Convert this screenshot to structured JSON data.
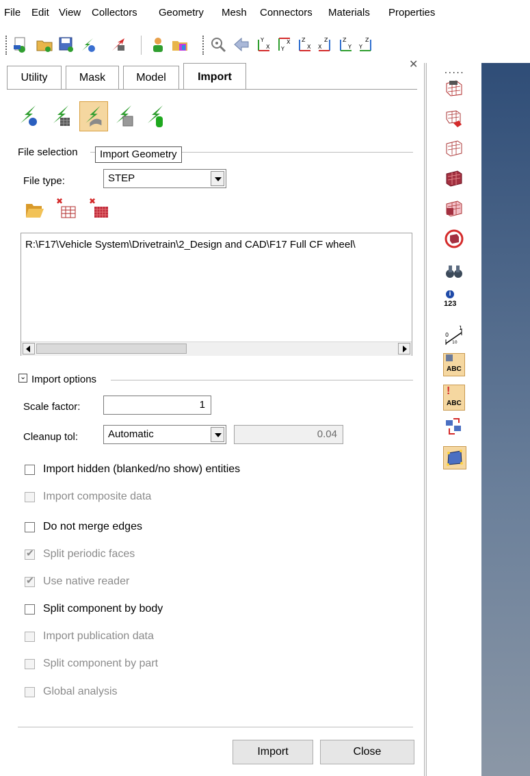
{
  "menu": [
    "File",
    "Edit",
    "View",
    "Collectors",
    "Geometry",
    "Mesh",
    "Connectors",
    "Materials",
    "Properties"
  ],
  "toolbar_icons": [
    "new-model-icon",
    "open-model-icon",
    "save-model-icon",
    "import-icon",
    "export-icon",
    "user-icon",
    "results-icon",
    "zoom-icon",
    "back-arrow-icon",
    "view-xy-top-icon",
    "view-xy-bottom-icon",
    "view-zx-icon",
    "view-xz-icon",
    "view-zy-icon",
    "view-yz-icon"
  ],
  "tabs": [
    {
      "label": "Utility"
    },
    {
      "label": "Mask"
    },
    {
      "label": "Model"
    },
    {
      "label": "Import",
      "active": true
    }
  ],
  "import_type_icons": [
    "import-model-icon",
    "import-fe-icon",
    "import-geometry-icon",
    "import-solver-deck-icon",
    "import-connectors-icon"
  ],
  "tooltip": "Import Geometry",
  "file_selection": {
    "title": "File selection",
    "file_type_label": "File type:",
    "file_type_value": "STEP",
    "icons": [
      "open-folder-icon",
      "remove-file-icon",
      "remove-all-files-icon"
    ],
    "path": "R:\\F17\\Vehicle System\\Drivetrain\\2_Design and CAD\\F17 Full CF wheel\\"
  },
  "import_options": {
    "title": "Import options",
    "scale_label": "Scale factor:",
    "scale_value": "1",
    "cleanup_label": "Cleanup tol:",
    "cleanup_mode": "Automatic",
    "cleanup_value": "0.04",
    "checkboxes": [
      {
        "label": "Import hidden (blanked/no show) entities",
        "checked": false,
        "enabled": true
      },
      {
        "label": "Import composite data",
        "checked": false,
        "enabled": false
      },
      {
        "label": "Do not merge edges",
        "checked": false,
        "enabled": true
      },
      {
        "label": "Split periodic faces",
        "checked": true,
        "enabled": false
      },
      {
        "label": "Use native reader",
        "checked": true,
        "enabled": false
      },
      {
        "label": "Split component by body",
        "checked": false,
        "enabled": true
      },
      {
        "label": "Import publication data",
        "checked": false,
        "enabled": false
      },
      {
        "label": "Split component by part",
        "checked": false,
        "enabled": false
      },
      {
        "label": "Global analysis",
        "checked": false,
        "enabled": false
      }
    ]
  },
  "buttons": {
    "import": "Import",
    "close": "Close"
  },
  "right_toolbar_icons": [
    "dots-menu-icon",
    "surface-mesh-icon",
    "remove-mesh-icon",
    "plane-mesh-icon",
    "solid-mesh-icon",
    "shaded-mesh-icon",
    "mesh-target-icon",
    "binoculars-icon",
    "info-123-icon",
    "measure-icon",
    "label-abc-icon",
    "error-label-abc-icon",
    "swap-elements-icon",
    "quality-frame-icon"
  ],
  "right_toolbar_text": {
    "info": "123",
    "abc1": "ABC",
    "abc2": "ABC"
  },
  "colors": {
    "accent_green": "#2f9e2f",
    "accent_red": "#d42a2a",
    "viewport_top": "#2f4d77",
    "viewport_bottom": "#8b97a6"
  }
}
